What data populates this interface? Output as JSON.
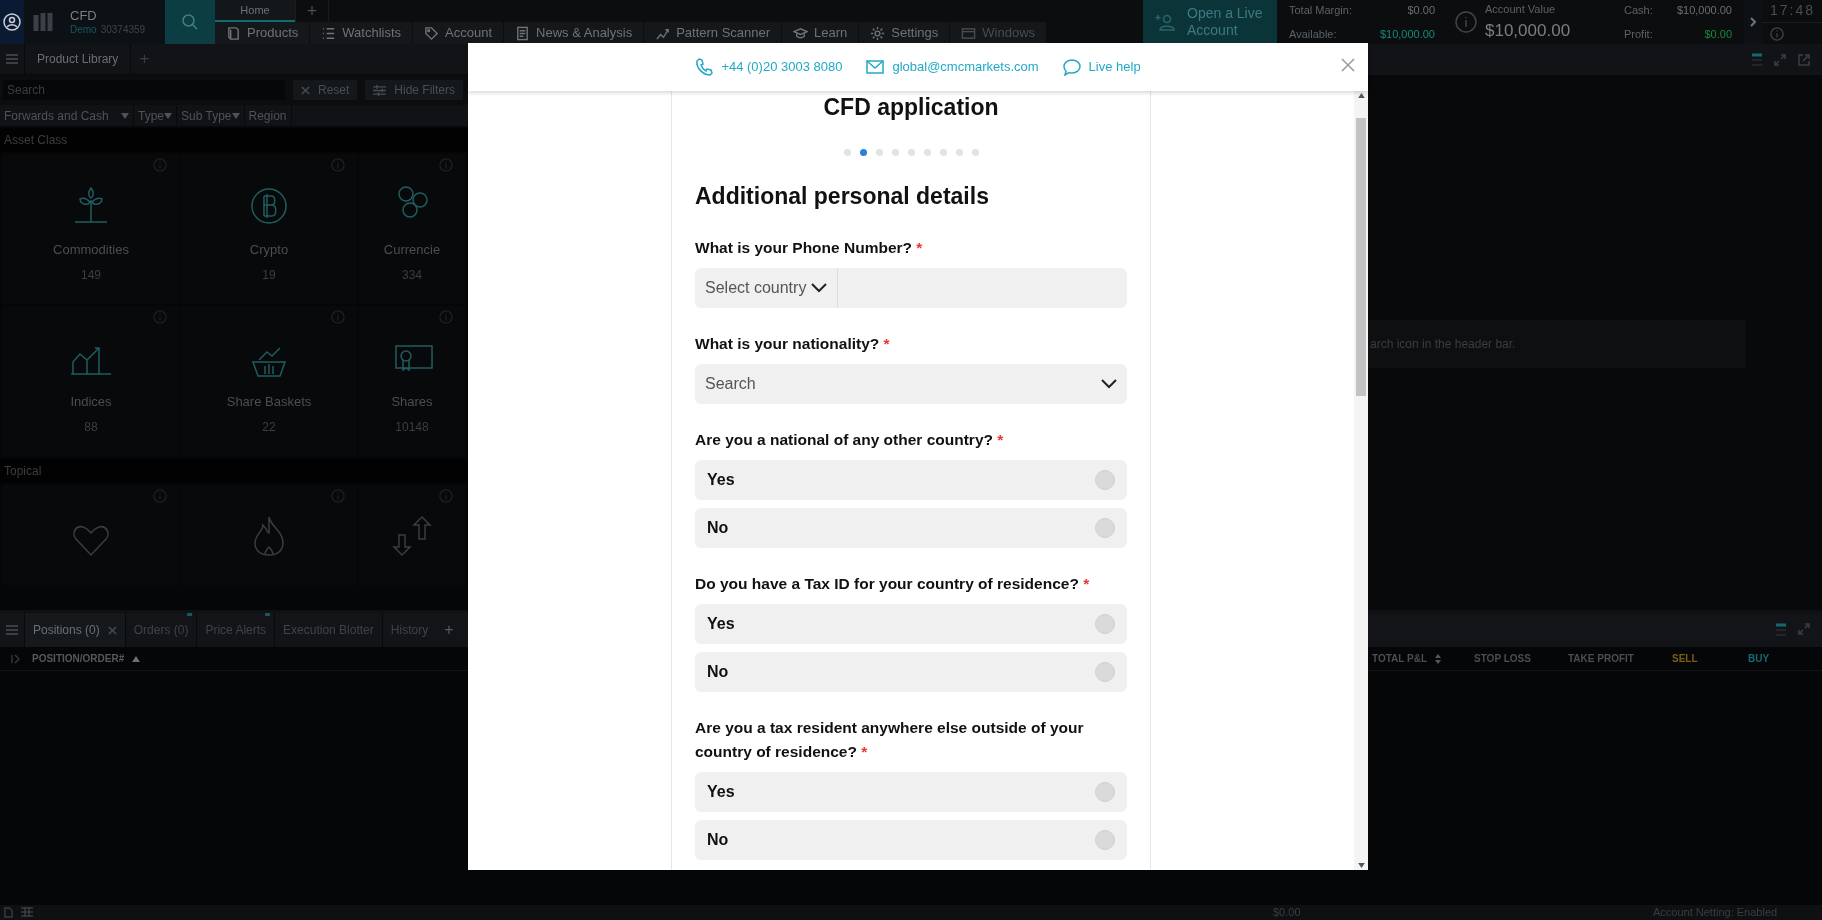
{
  "top_bar": {
    "account": {
      "name": "CFD",
      "mode": "Demo",
      "number": "30374359"
    },
    "tabs": [
      {
        "label": "Home",
        "selected": true
      }
    ],
    "add_tab": "+",
    "nav": [
      {
        "label": "Products",
        "disabled": false
      },
      {
        "label": "Watchlists",
        "disabled": false
      },
      {
        "label": "Account",
        "disabled": false
      },
      {
        "label": "News & Analysis",
        "disabled": false
      },
      {
        "label": "Pattern Scanner",
        "disabled": false
      },
      {
        "label": "Learn",
        "disabled": false
      },
      {
        "label": "Settings",
        "disabled": false
      },
      {
        "label": "Windows",
        "disabled": true
      }
    ],
    "live_account_button": "Open a Live Account",
    "summary_left": [
      {
        "label": "Total Margin:",
        "value": "$0.00"
      },
      {
        "label": "Available:",
        "value": "$10,000.00"
      }
    ],
    "account_value": {
      "label": "Account Value",
      "value": "$10,000.00"
    },
    "summary_right": [
      {
        "label": "Cash:",
        "value": "$10,000.00"
      },
      {
        "label": "Profit:",
        "value": "$0.00"
      }
    ],
    "clock": "17:48"
  },
  "product_library": {
    "title": "Product Library",
    "add": "+",
    "search_placeholder": "Search",
    "reset": "Reset",
    "hide_filters": "Hide Filters",
    "filters": [
      {
        "label": "Forwards and Cash",
        "caret": true
      },
      {
        "label": "Type",
        "caret": true
      },
      {
        "label": "Sub Type",
        "caret": true
      },
      {
        "label": "Region",
        "caret": false
      }
    ],
    "sections": [
      {
        "title": "Asset Class",
        "tiles": [
          {
            "label": "Commodities",
            "count": "149"
          },
          {
            "label": "Crypto",
            "count": "19"
          },
          {
            "label": "Currencie",
            "count": "334"
          },
          {
            "label": "Indices",
            "count": "88"
          },
          {
            "label": "Share Baskets",
            "count": "22"
          },
          {
            "label": "Shares",
            "count": "10148"
          }
        ]
      },
      {
        "title": "Topical",
        "tiles": [
          {
            "kind": "tile"
          },
          {
            "kind": "tile"
          },
          {
            "kind": "tile"
          }
        ]
      }
    ]
  },
  "right_panel": {
    "hint": "arch icon in the header bar."
  },
  "positions_panel": {
    "tabs": [
      {
        "label": "Positions (0)",
        "selected": true,
        "closable": true,
        "badge": false
      },
      {
        "label": "Orders (0)",
        "selected": false,
        "closable": false,
        "badge": true
      },
      {
        "label": "Price Alerts",
        "selected": false,
        "closable": false,
        "badge": true
      },
      {
        "label": "Execution Blotter",
        "selected": false,
        "closable": false,
        "badge": false
      },
      {
        "label": "History",
        "selected": false,
        "closable": false,
        "badge": false
      }
    ],
    "add": "+",
    "left_columns": [
      "POSITION/ORDER#"
    ],
    "right_columns": [
      "TOTAL P&L",
      "STOP LOSS",
      "TAKE PROFIT",
      "SELL",
      "BUY"
    ]
  },
  "status_bar": {
    "total": "$0.00",
    "netting": "Account Netting: Enabled"
  },
  "modal": {
    "contacts": [
      {
        "kind": "phone",
        "label": "+44 (0)20 3003 8080"
      },
      {
        "kind": "email",
        "label": "global@cmcmarkets.com"
      },
      {
        "kind": "chat",
        "label": "Live help"
      }
    ],
    "title": "CFD application",
    "steps": [
      {
        "selected": false
      },
      {
        "selected": true
      },
      {
        "selected": false
      },
      {
        "selected": false
      },
      {
        "selected": false
      },
      {
        "selected": false
      },
      {
        "selected": false
      },
      {
        "selected": false
      },
      {
        "selected": false
      }
    ],
    "heading": "Additional personal details",
    "questions": [
      {
        "kind": "phone",
        "label": "What is your Phone Number?",
        "required_mark": "*",
        "placeholder": "Select country"
      },
      {
        "kind": "select",
        "label": "What is your nationality?",
        "required_mark": "*",
        "placeholder": "Search"
      },
      {
        "kind": "radio",
        "label": "Are you a national of any other country?",
        "required_mark": "*",
        "options": [
          {
            "label": "Yes",
            "selected": false
          },
          {
            "label": "No",
            "selected": false
          }
        ]
      },
      {
        "kind": "radio",
        "label": "Do you have a Tax ID for your country of residence?",
        "required_mark": "*",
        "options": [
          {
            "label": "Yes",
            "selected": false
          },
          {
            "label": "No",
            "selected": false
          }
        ]
      },
      {
        "kind": "radio",
        "label": "Are you a tax resident anywhere else outside of your country of residence?",
        "required_mark": "*",
        "options": [
          {
            "label": "Yes",
            "selected": false
          },
          {
            "label": "No",
            "selected": false
          }
        ]
      }
    ]
  }
}
